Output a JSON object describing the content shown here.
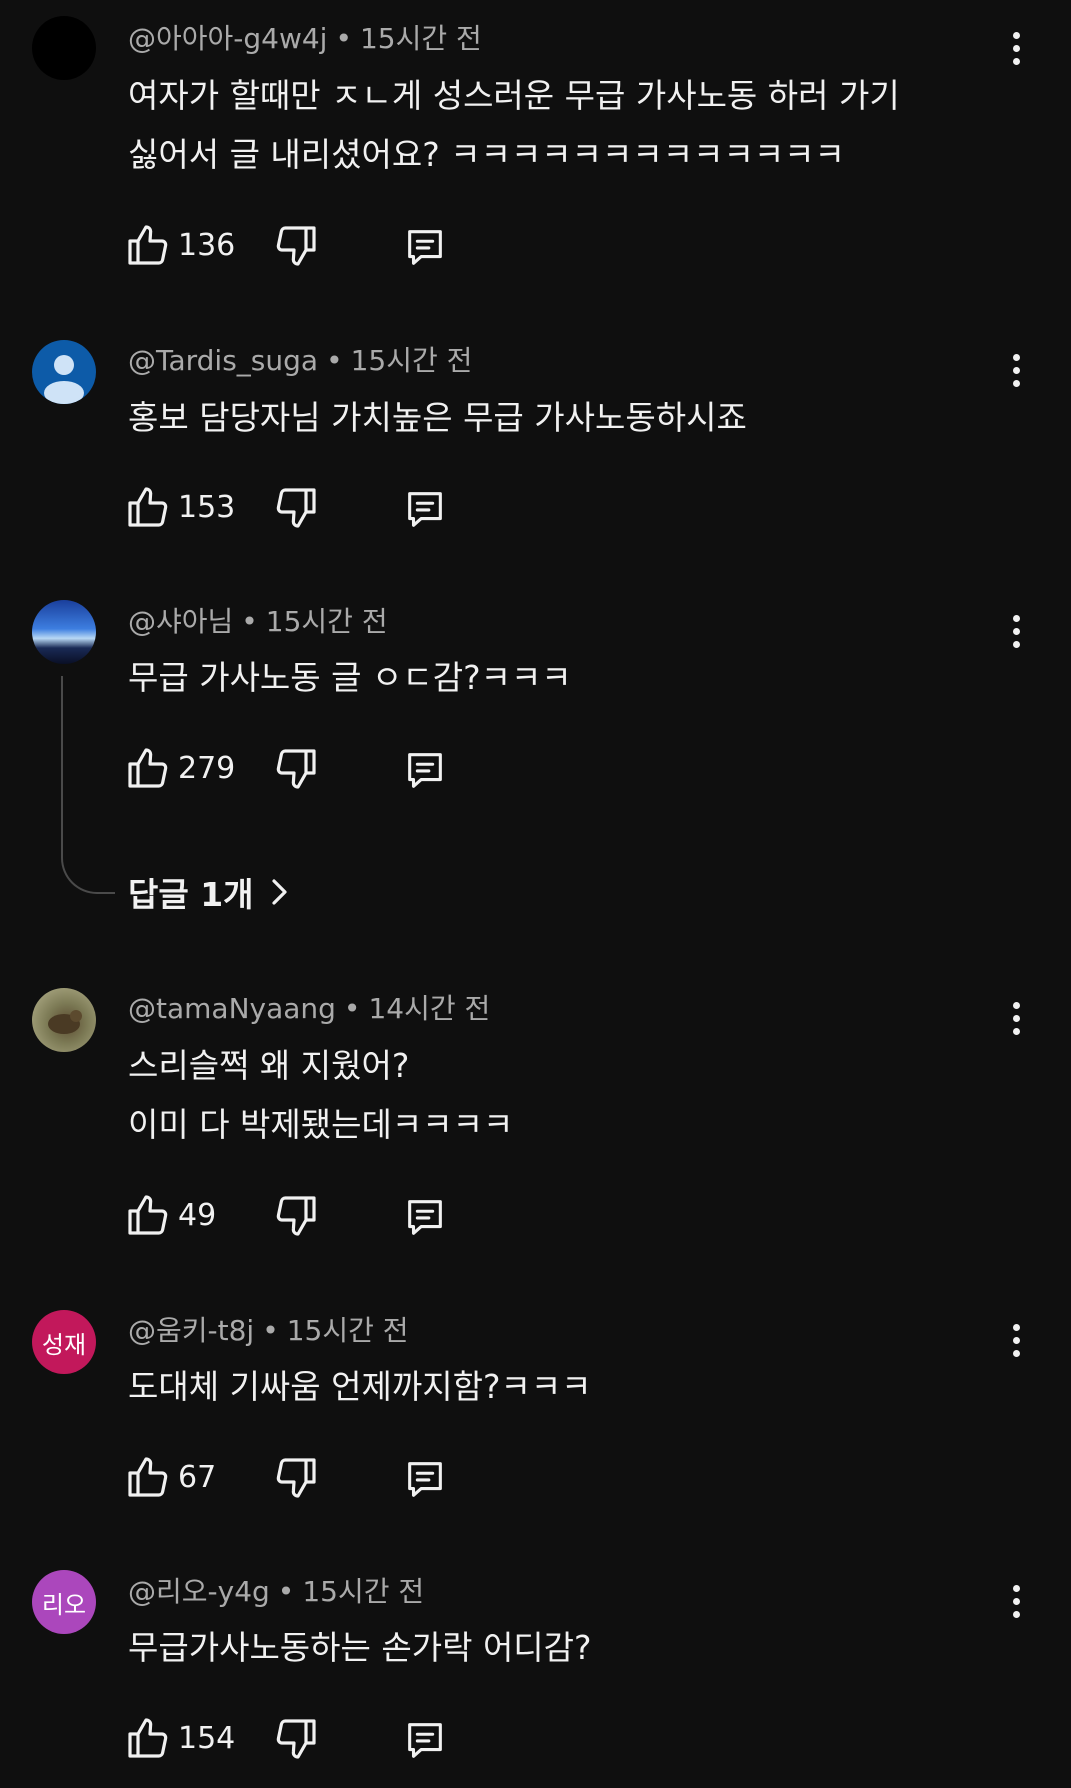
{
  "comments": [
    {
      "author": "@아아아-g4w4j",
      "time": "15시간 전",
      "lines": [
        "여자가 할때만 ㅈㄴ게 성스러운 무급 가사노동 하러 가기",
        "싫어서 글 내리셨어요? ㅋㅋㅋㅋㅋㅋㅋㅋㅋㅋㅋㅋㅋ"
      ],
      "likes": "136",
      "avatar_initials": "",
      "avatar_color": "#000000"
    },
    {
      "author": "@Tardis_suga",
      "time": "15시간 전",
      "lines": [
        "홍보 담당자님 가치높은 무급 가사노동하시죠"
      ],
      "likes": "153",
      "avatar_initials": "",
      "avatar_color": "#0d5ba8"
    },
    {
      "author": "@샤아님",
      "time": "15시간 전",
      "lines": [
        "무급 가사노동 글 ㅇㄷ감?ㅋㅋㅋ"
      ],
      "likes": "279",
      "avatar_initials": "",
      "avatar_color": "#1b3f8f",
      "replies_label": "답글 1개"
    },
    {
      "author": "@tamaNyaang",
      "time": "14시간 전",
      "lines": [
        "스리슬쩍 왜 지웠어?",
        "이미 다 박제됐는데ㅋㅋㅋㅋ"
      ],
      "likes": "49",
      "avatar_initials": "",
      "avatar_color": "#6b6a45"
    },
    {
      "author": "@움키-t8j",
      "time": "15시간 전",
      "lines": [
        "도대체 기싸움 언제까지함?ㅋㅋㅋ"
      ],
      "likes": "67",
      "avatar_initials": "성재",
      "avatar_color": "#c2185b"
    },
    {
      "author": "@리오-y4g",
      "time": "15시간 전",
      "lines": [
        "무급가사노동하는 손가락 어디감?"
      ],
      "likes": "154",
      "avatar_initials": "리오",
      "avatar_color": "#ab47bc"
    }
  ],
  "icons": {
    "like": "thumbs-up-icon",
    "dislike": "thumbs-down-icon",
    "reply": "comment-icon",
    "more": "more-vertical-icon",
    "chevron": "chevron-right-icon"
  }
}
